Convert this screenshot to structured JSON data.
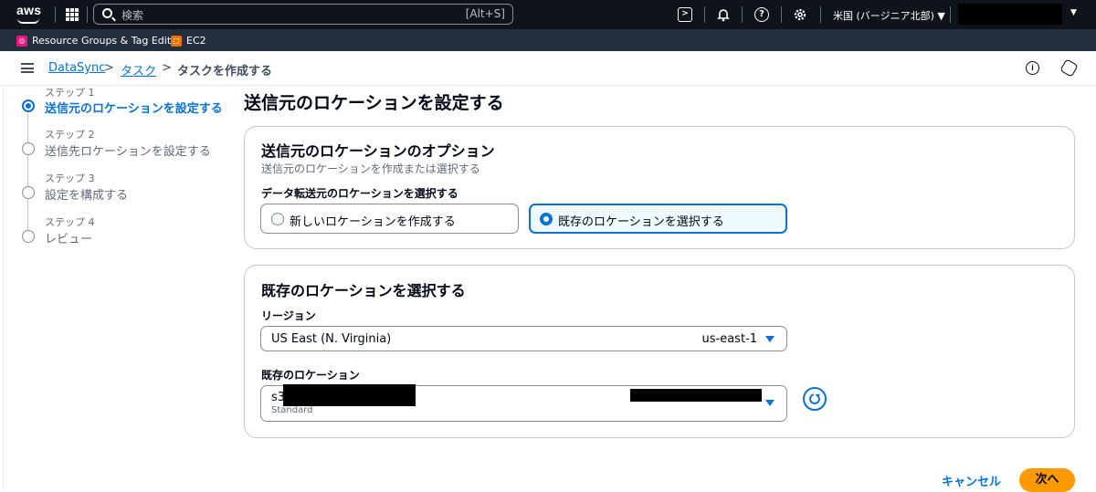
{
  "topnav": {
    "logo": "aws",
    "search_placeholder": "検索",
    "search_shortcut": "[Alt+S]",
    "icons": [
      "cloudshell-icon",
      "bell-icon",
      "help-icon",
      "settings-icon"
    ],
    "region": "米国 (バージニア北部) ▼"
  },
  "favorites": [
    {
      "label": "Resource Groups & Tag Editor",
      "color": "#e7157b"
    },
    {
      "label": "EC2",
      "color": "#ed7100"
    }
  ],
  "breadcrumb": {
    "items": [
      "DataSync",
      "タスク"
    ],
    "current": "タスクを作成する"
  },
  "steps": [
    {
      "label": "ステップ 1",
      "title": "送信元のロケーションを設定する",
      "active": true
    },
    {
      "label": "ステップ 2",
      "title": "送信先ロケーションを設定する",
      "active": false
    },
    {
      "label": "ステップ 3",
      "title": "設定を構成する",
      "active": false
    },
    {
      "label": "ステップ 4",
      "title": "レビュー",
      "active": false
    }
  ],
  "page_title": "送信元のロケーションを設定する",
  "options_card": {
    "heading": "送信元のロケーションのオプション",
    "description": "送信元のロケーションを作成または選択する",
    "field_label": "データ転送元のロケーションを選択する",
    "choice_new": "新しいロケーションを作成する",
    "choice_existing": "既存のロケーションを選択する",
    "selected": "existing"
  },
  "existing_card": {
    "heading": "既存のロケーションを選択する",
    "region_label": "リージョン",
    "region_value": "US East (N. Virginia)",
    "region_code": "us-east-1",
    "location_label": "既存のロケーション",
    "location_value": "s3:",
    "location_sub": "Standard"
  },
  "actions": {
    "cancel": "キャンセル",
    "next": "次へ"
  },
  "colors": {
    "accent": "#0972d3",
    "primary_button": "#ff9900",
    "nav_bg": "#0f141a",
    "fav_bg": "#232f3e"
  }
}
